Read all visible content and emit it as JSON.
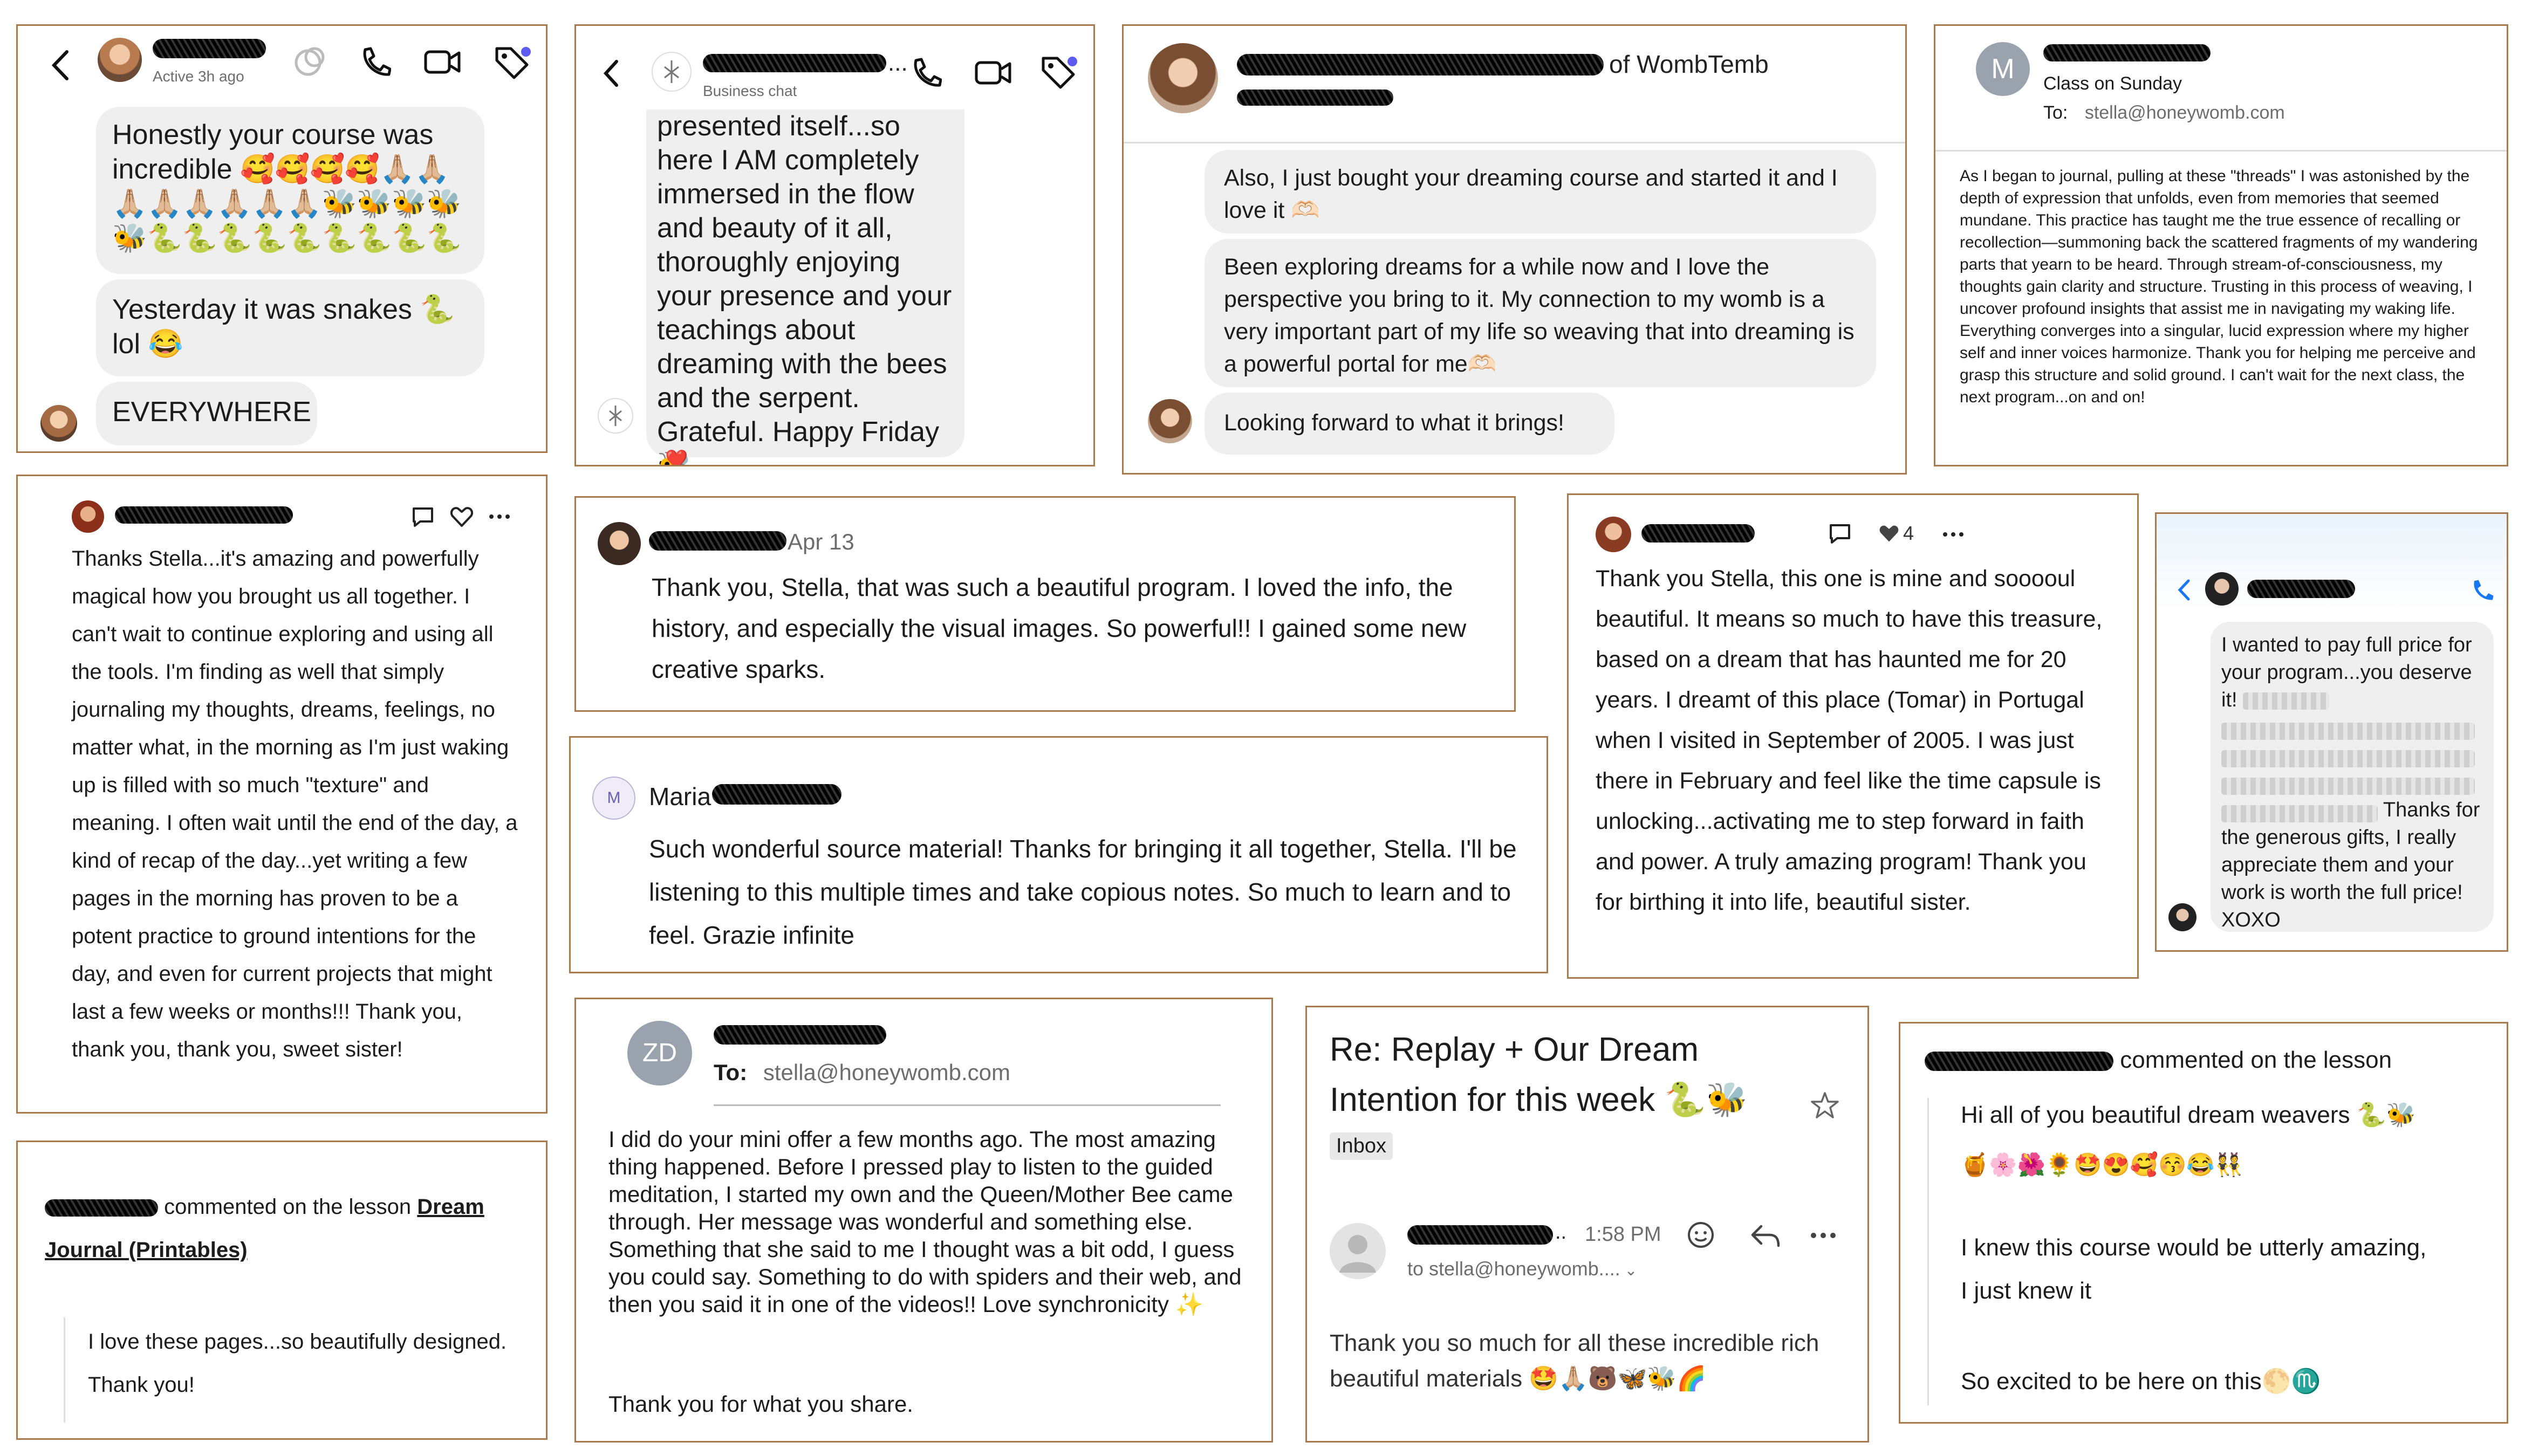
{
  "c1": {
    "status": "Active 3h ago",
    "b1": "Honestly your course was incredible 🥰🥰🥰🥰🙏🏼🙏🏼🙏🏼🙏🏼🙏🏼🙏🏼🙏🏼🙏🏼🐝🐝🐝🐝🐝🐍🐍🐍🐍🐍🐍🐍🐍🐍",
    "b2": "Yesterday it was snakes 🐍 lol 😂",
    "b3": "EVERYWHERE"
  },
  "c2": {
    "subtitle": "Business chat",
    "body": "presented itself...so here I AM completely immersed in the flow and beauty of it all, thoroughly enjoying your presence and your teachings about dreaming with the bees and the serpent. Grateful.  Happy Friday 🐝",
    "reaction": "❤️"
  },
  "c3": {
    "title_suffix": "of WombTemb",
    "b1": "Also, I just bought your dreaming course and started it and I love it 🫶🏻",
    "b2": "Been exploring dreams for a while now and I love the perspective you bring to it. My connection to my womb is a very important part of my life so weaving that into dreaming is a powerful portal for me🫶🏻",
    "b3": "Looking forward to what it brings!"
  },
  "c4": {
    "avatar_letter": "M",
    "subject": "Class on Sunday",
    "to_label": "To:",
    "to_addr": "stella@honeywomb.com",
    "body": "As I began to journal, pulling at these \"threads\" I was astonished by the depth of expression that unfolds, even from memories that seemed mundane. This practice has taught me the true essence of recalling or recollection—summoning back the scattered fragments of my wandering parts that yearn to be heard. Through stream-of-consciousness, my thoughts gain clarity and structure. Trusting in this process of weaving, I uncover profound insights that assist me in navigating my waking life. Everything converges into a singular, lucid expression where my higher self and inner voices harmonize. Thank you for helping me perceive and grasp this structure and solid ground. I can't wait for the next class, the next program...on and on!"
  },
  "c5": {
    "body": "Thanks Stella...it's amazing and powerfully magical how you brought us all together. I can't wait to continue exploring and using all the tools. I'm finding as well that simply journaling my thoughts, dreams, feelings, no matter what, in the morning as I'm just waking up is filled with so much \"texture\" and meaning. I often wait until the end of the day, a kind of recap of the day...yet writing a few pages in the morning has proven to be a potent practice to ground intentions for the day, and even for current projects that might last a few weeks or months!!! Thank you, thank you, thank you, sweet sister!"
  },
  "c6": {
    "date": "Apr 13",
    "body": "Thank you, Stella, that was such a beautiful program. I loved the info, the history, and especially the visual images. So powerful!! I gained some new creative sparks."
  },
  "c7": {
    "avatar_letter": "M",
    "name": "Maria",
    "body": "Such wonderful source material! Thanks for bringing it all together, Stella. I'll be listening to this multiple times and take copious notes. So much to learn and to feel. Grazie infinite"
  },
  "c8": {
    "likes": "4",
    "body": "Thank you Stella, this one is mine and sooooul beautiful. It means so much to have this treasure, based on a dream that has haunted me for 20 years. I dreamt of this place (Tomar) in Portugal when I visited in September of 2005. I was just there in February and feel like the time capsule is unlocking...activating me to step forward in faith and power. A truly amazing program! Thank you for birthing it into life, beautiful sister."
  },
  "c9": {
    "line1": "I wanted to pay full price for your program...you deserve it!",
    "line2": "Thanks for the generous gifts, I really appreciate them and your work is worth the full price! XOXO"
  },
  "c10": {
    "commented": "commented on the lesson",
    "lesson": "Dream Journal (Printables)",
    "body": "I love these pages...so beautifully designed. Thank you!"
  },
  "c11": {
    "initials": "ZD",
    "to_label": "To:",
    "to_addr": "stella@honeywomb.com",
    "body": "I did do your mini offer a few months ago. The most amazing thing happened. Before I pressed play to listen to the guided meditation, I started my own and the Queen/Mother Bee came through. Her message was wonderful and something else. Something that she said to me I thought was a bit odd, I guess you could say. Something to do with spiders and their web, and then you said it in one of the videos!! Love synchronicity ✨",
    "closing": "Thank you for what you share."
  },
  "c12": {
    "subject": "Re: Replay + Our Dream Intention for this week 🐍🐝",
    "label": "Inbox",
    "time": "1:58 PM",
    "to": "to stella@honeywomb....",
    "body": "Thank you so much for all these incredible rich beautiful materials 🤩🙏🏼🐻🦋🐝🌈"
  },
  "c13": {
    "commented": "commented on the lesson",
    "greeting": "Hi all of you beautiful dream weavers 🐍🐝",
    "emojis": "🍯🌸🌺🌻🤩😍🥰😚😂👯",
    "p1": "I knew this course would be utterly amazing, I just knew it",
    "p2": "So excited to be here on this🌕♏"
  },
  "colors": {
    "frame": "#a97a4d",
    "bubble": "#efefef",
    "accent_blue": "#1877f2",
    "notify_dot": "#5b5bf0"
  },
  "icons": [
    "back-icon",
    "effects-icon",
    "phone-icon",
    "video-icon",
    "tag-icon",
    "comment-icon",
    "heart-icon",
    "more-icon",
    "star-icon",
    "emoji-icon",
    "reply-icon"
  ]
}
